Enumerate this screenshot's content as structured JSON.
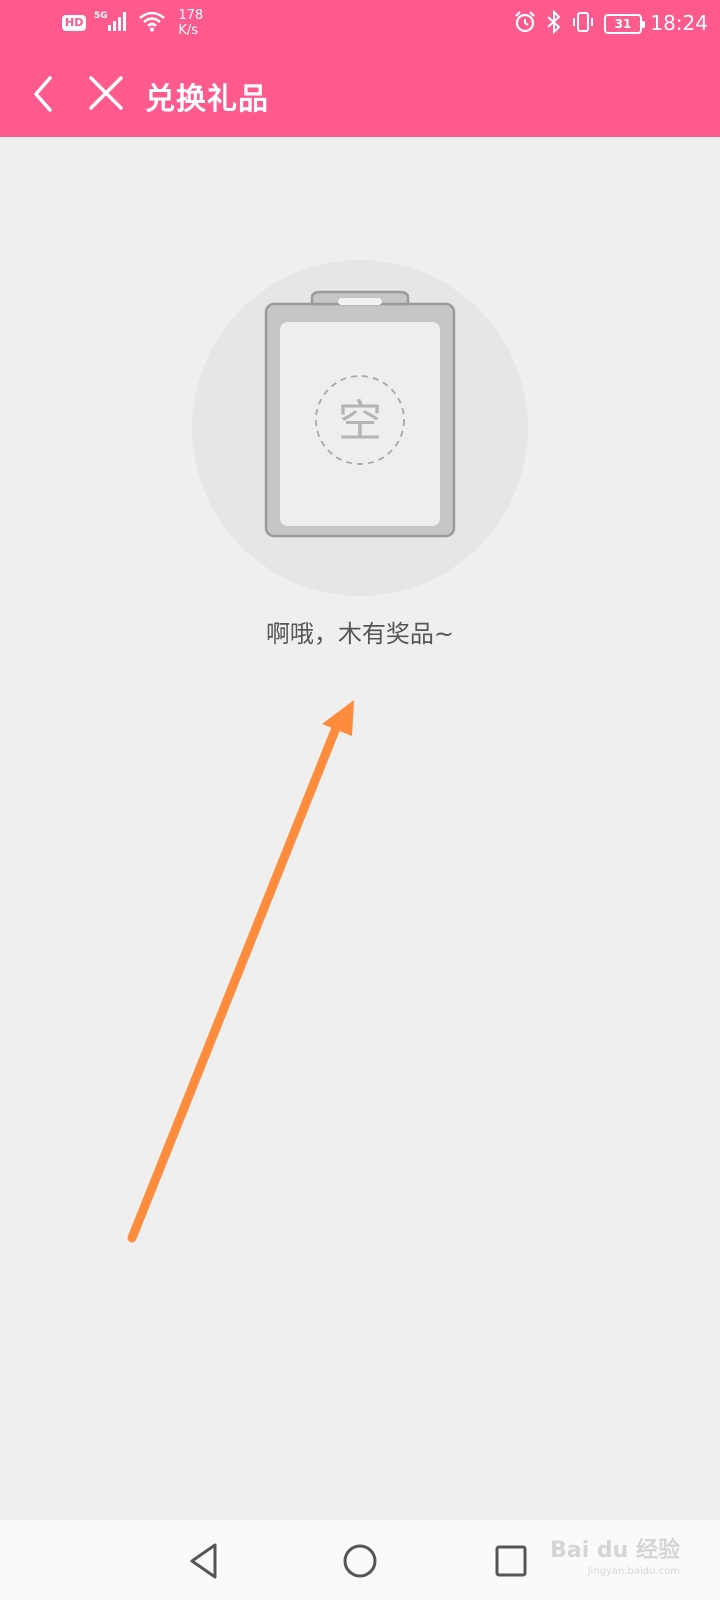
{
  "status_bar": {
    "hd": "HD",
    "network": "5G",
    "net_speed_value": "178",
    "net_speed_unit": "K/s",
    "battery": "31",
    "time": "18:24",
    "icons": [
      "hd-icon",
      "signal-5g-icon",
      "wifi-icon",
      "alarm-icon",
      "bluetooth-icon",
      "vibrate-icon",
      "battery-icon"
    ]
  },
  "app_bar": {
    "title": "兑换礼品",
    "back_icon": "chevron-left-icon",
    "close_icon": "close-icon"
  },
  "empty_state": {
    "badge_text": "空",
    "message": "啊哦，木有奖品~"
  },
  "nav_bar": {
    "icons": [
      "back-triangle-icon",
      "home-circle-icon",
      "recents-square-icon"
    ]
  },
  "watermark": {
    "text": "Bai du 经验",
    "sub": "jingyan.baidu.com"
  },
  "colors": {
    "accent": "#fe5a8e",
    "background": "#efefef",
    "annotation_arrow": "#ff8c3c"
  }
}
